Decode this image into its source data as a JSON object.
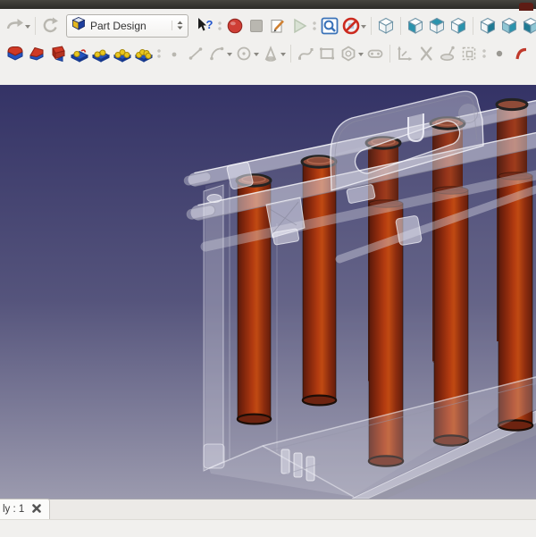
{
  "toolbar": {
    "workbench_selector": {
      "value": "Part Design",
      "icon": "freecad-cube-icon"
    },
    "row1": [
      {
        "type": "button",
        "name": "redo",
        "icon": "redo-icon",
        "enabled": false,
        "dropdown": true
      },
      {
        "type": "separator"
      },
      {
        "type": "button",
        "name": "refresh",
        "icon": "refresh-icon",
        "enabled": false
      },
      {
        "type": "combobox",
        "name": "workbench-selector"
      },
      {
        "type": "button",
        "name": "whats-this",
        "icon": "whats-this-icon",
        "enabled": true
      },
      {
        "type": "separator-dots"
      },
      {
        "type": "button",
        "name": "macro-record",
        "icon": "macro-record-icon",
        "enabled": true
      },
      {
        "type": "button",
        "name": "macro-stop",
        "icon": "macro-stop-icon",
        "enabled": false
      },
      {
        "type": "button",
        "name": "macro-edit",
        "icon": "macro-edit-icon",
        "enabled": true
      },
      {
        "type": "button",
        "name": "macro-play",
        "icon": "macro-play-icon",
        "enabled": false
      },
      {
        "type": "separator-dots"
      },
      {
        "type": "button",
        "name": "view-fit-all",
        "icon": "view-fit-icon",
        "enabled": true
      },
      {
        "type": "button",
        "name": "draw-style",
        "icon": "draw-style-icon",
        "enabled": true,
        "dropdown": true
      },
      {
        "type": "separator"
      },
      {
        "type": "button",
        "name": "view-axonometric",
        "icon": "cube-axonometric-icon",
        "enabled": true
      },
      {
        "type": "separator"
      },
      {
        "type": "button",
        "name": "view-front",
        "icon": "cube-front-icon",
        "enabled": true
      },
      {
        "type": "button",
        "name": "view-top",
        "icon": "cube-top-icon",
        "enabled": true
      },
      {
        "type": "button",
        "name": "view-right",
        "icon": "cube-right-icon",
        "enabled": true
      },
      {
        "type": "separator"
      },
      {
        "type": "button",
        "name": "view-rear",
        "icon": "cube-rear-icon",
        "enabled": true
      },
      {
        "type": "button",
        "name": "view-bottom",
        "icon": "cube-bottom-icon",
        "enabled": true
      },
      {
        "type": "button",
        "name": "view-left",
        "icon": "cube-left-icon",
        "enabled": true
      },
      {
        "type": "separator"
      },
      {
        "type": "button",
        "name": "clipped-right",
        "icon": "clipped-teal-icon",
        "enabled": true
      }
    ],
    "row2": [
      {
        "type": "button",
        "name": "fillet",
        "icon": "fillet-icon",
        "enabled": true
      },
      {
        "type": "button",
        "name": "chamfer",
        "icon": "chamfer-icon",
        "enabled": true
      },
      {
        "type": "button",
        "name": "draft",
        "icon": "draft-icon",
        "enabled": true
      },
      {
        "type": "button",
        "name": "mirrored",
        "icon": "mirrored-icon",
        "enabled": true
      },
      {
        "type": "button",
        "name": "linear-pattern",
        "icon": "linear-pattern-icon",
        "enabled": true
      },
      {
        "type": "button",
        "name": "polar-pattern",
        "icon": "polar-pattern-icon",
        "enabled": true
      },
      {
        "type": "button",
        "name": "multi-transform",
        "icon": "multi-transform-icon",
        "enabled": true
      },
      {
        "type": "separator-dots"
      },
      {
        "type": "button",
        "name": "sketch-point",
        "icon": "point-icon",
        "enabled": false
      },
      {
        "type": "button",
        "name": "sketch-line",
        "icon": "line-icon",
        "enabled": false
      },
      {
        "type": "button",
        "name": "sketch-arc",
        "icon": "arc-icon",
        "enabled": false,
        "dropdown": true
      },
      {
        "type": "button",
        "name": "sketch-circle",
        "icon": "circle-icon",
        "enabled": false,
        "dropdown": true
      },
      {
        "type": "button",
        "name": "sketch-conics",
        "icon": "conics-icon",
        "enabled": false,
        "dropdown": true
      },
      {
        "type": "separator"
      },
      {
        "type": "button",
        "name": "sketch-bspline",
        "icon": "bspline-icon",
        "enabled": false
      },
      {
        "type": "button",
        "name": "sketch-rectangle",
        "icon": "rectangle-icon",
        "enabled": false
      },
      {
        "type": "button",
        "name": "sketch-polygon",
        "icon": "polygon-icon",
        "enabled": false,
        "dropdown": true
      },
      {
        "type": "button",
        "name": "sketch-slot",
        "icon": "slot-icon",
        "enabled": false
      },
      {
        "type": "separator"
      },
      {
        "type": "button",
        "name": "external-geometry",
        "icon": "external-geometry-icon",
        "enabled": false
      },
      {
        "type": "button",
        "name": "trim-edge",
        "icon": "trim-x-icon",
        "enabled": false
      },
      {
        "type": "button",
        "name": "carbon-copy",
        "icon": "carbon-copy-icon",
        "enabled": false
      },
      {
        "type": "button",
        "name": "edit-region",
        "icon": "edit-region-icon",
        "enabled": false
      },
      {
        "type": "separator-dots"
      },
      {
        "type": "button",
        "name": "toggle-construction",
        "icon": "construction-dot-icon",
        "enabled": false
      },
      {
        "type": "button",
        "name": "clipped-right-2",
        "icon": "clipped-red-icon",
        "enabled": true
      }
    ]
  },
  "viewport": {
    "model_visible": "translucent battery case with red cylindrical cells and carry handle",
    "visible_cell_count": 5,
    "visible_rim_count": 5
  },
  "document_tab": {
    "label": "ly : 1"
  },
  "colors": {
    "viewport_top": "#343366",
    "viewport_bottom": "#9b9aae",
    "cell_red": "#b23a10",
    "cell_dark": "#58190b",
    "case_translucent": "rgba(214,214,226,0.42)",
    "toolbar_bg": "#f1f0ee",
    "titlebar": "#383732",
    "record_red": "#ce3e35",
    "view_teal": "#2a93ad",
    "fit_blue": "#3a72b8",
    "icon_blue": "#2553be",
    "icon_red": "#cf3a26",
    "icon_yellow": "#e9c71f",
    "disabled_gray": "#b9b7b0"
  }
}
